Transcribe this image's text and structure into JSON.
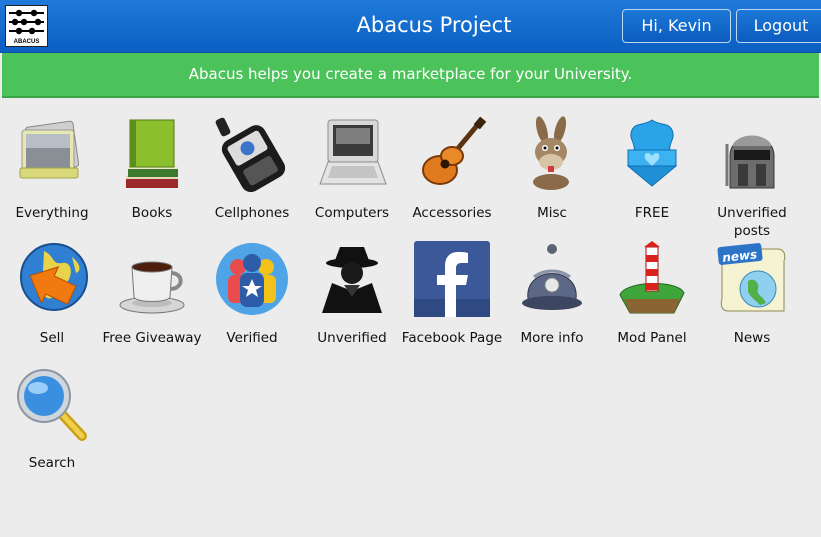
{
  "header": {
    "logo_text": "ABACUS",
    "title": "Abacus Project",
    "greeting_button": "Hi, Kevin",
    "logout_button": "Logout"
  },
  "banner": {
    "text": "Abacus helps you create a marketplace for your University."
  },
  "colors": {
    "header_blue": "#0a5fc2",
    "banner_green": "#4cc25a",
    "page_background": "#ececec"
  },
  "tiles": [
    {
      "label": "Everything",
      "icon": "files-icon"
    },
    {
      "label": "Books",
      "icon": "books-icon"
    },
    {
      "label": "Cellphones",
      "icon": "cellphone-icon"
    },
    {
      "label": "Computers",
      "icon": "laptop-icon"
    },
    {
      "label": "Accessories",
      "icon": "guitar-icon"
    },
    {
      "label": "Misc",
      "icon": "donkey-icon"
    },
    {
      "label": "FREE",
      "icon": "free-gift-icon"
    },
    {
      "label": "Unverified posts",
      "icon": "helmet-icon"
    },
    {
      "label": "Sell",
      "icon": "globe-arrow-icon"
    },
    {
      "label": "Free Giveaway",
      "icon": "coffee-cup-icon"
    },
    {
      "label": "Verified",
      "icon": "verified-people-icon"
    },
    {
      "label": "Unverified",
      "icon": "spy-icon"
    },
    {
      "label": "Facebook Page",
      "icon": "facebook-icon"
    },
    {
      "label": "More info",
      "icon": "police-helmet-icon"
    },
    {
      "label": "Mod Panel",
      "icon": "lighthouse-icon"
    },
    {
      "label": "News",
      "icon": "news-icon"
    },
    {
      "label": "Search",
      "icon": "magnifier-icon"
    }
  ]
}
